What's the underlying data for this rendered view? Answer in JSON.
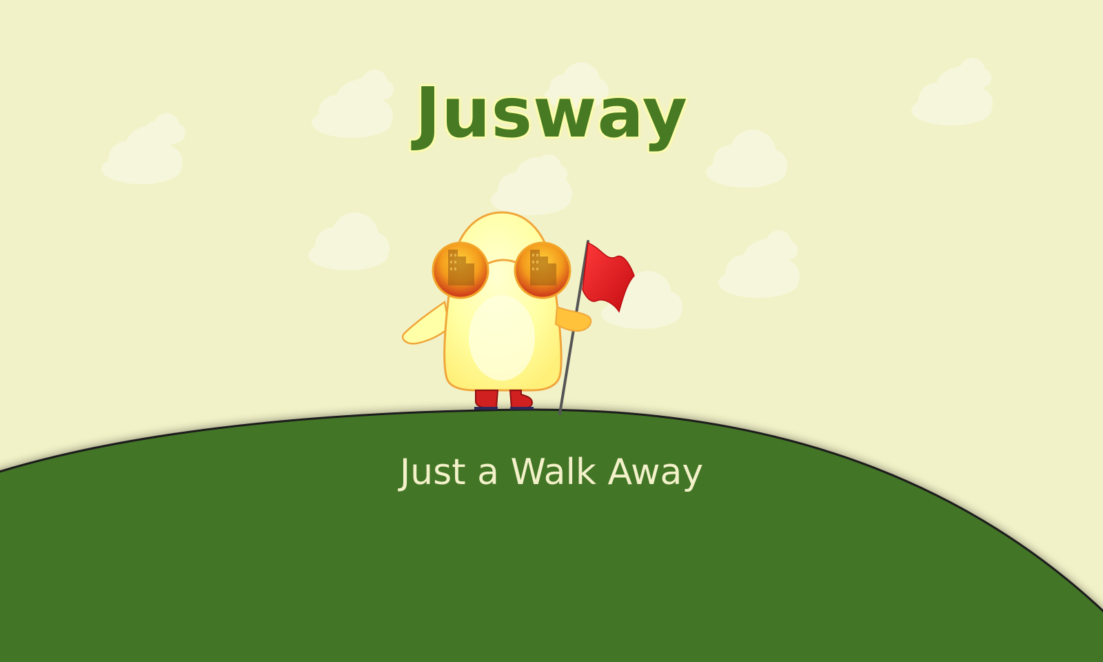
{
  "app": {
    "title": "Jusway",
    "tagline": "Just a Walk Away"
  },
  "colors": {
    "sky": "#f2f2c8",
    "hill": "#427428",
    "title": "#477a23",
    "tagline": "#f3f1c9",
    "mascot_body": "#ffff9e",
    "mascot_outline": "#f0a63a",
    "flag": "#e0151a",
    "boots": "#d0201f"
  },
  "icons": {
    "mascot": "mascot-icon",
    "flag": "flag-icon",
    "cloud": "cloud-icon"
  }
}
